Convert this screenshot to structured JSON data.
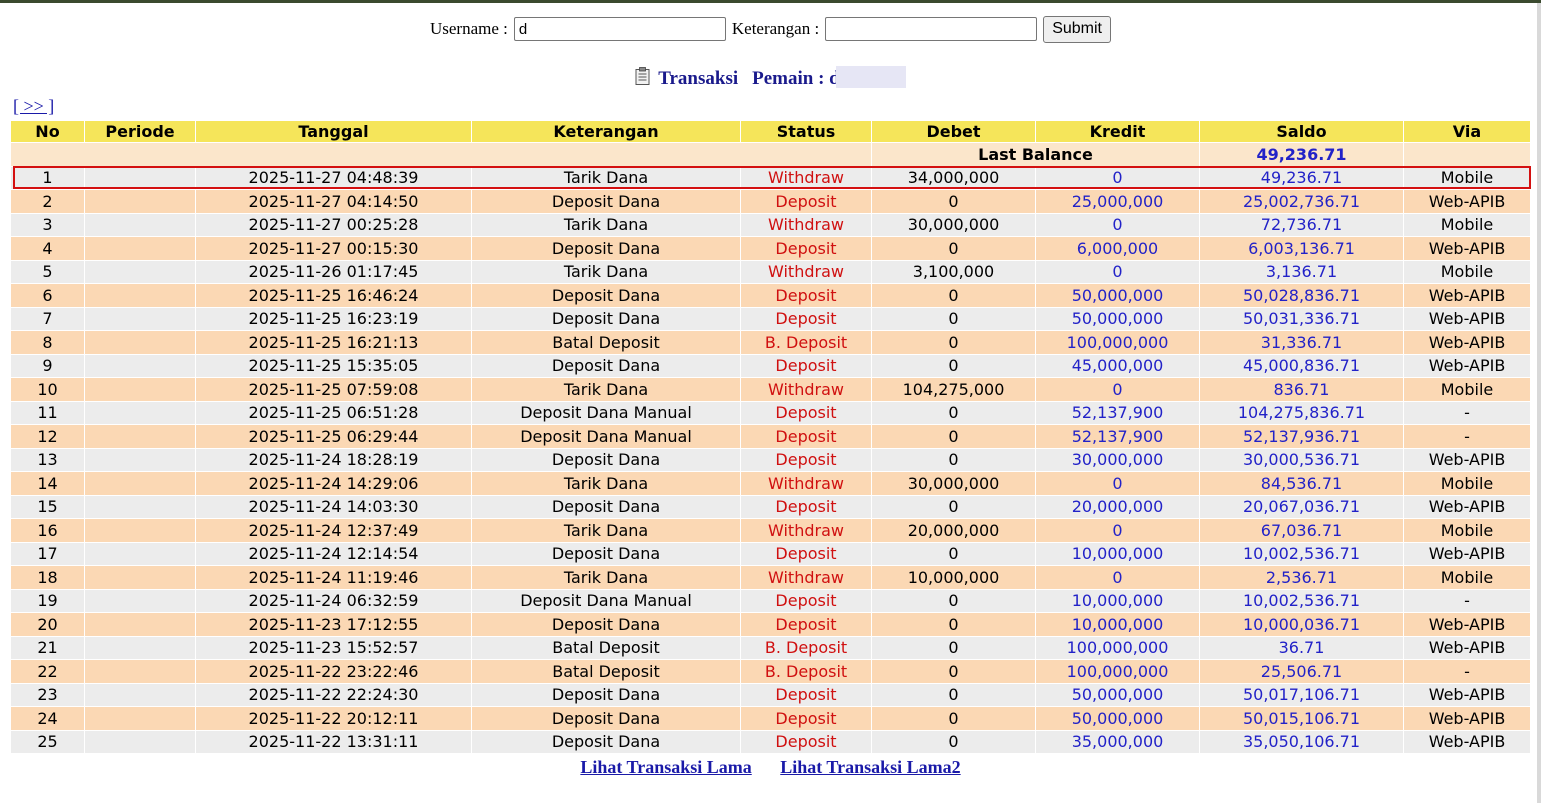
{
  "form": {
    "username_label": "Username :",
    "username_value": "d",
    "keterangan_label": "Keterangan :",
    "keterangan_value": "",
    "submit_label": "Submit"
  },
  "title": {
    "icon": "clipboard-icon",
    "transaksi": "Transaksi",
    "pemain_label": "Pemain : d"
  },
  "nav": {
    "next_label": "[ >> ]"
  },
  "table": {
    "headers": [
      "No",
      "Periode",
      "Tanggal",
      "Keterangan",
      "Status",
      "Debet",
      "Kredit",
      "Saldo",
      "Via"
    ],
    "last_balance_label": "Last Balance",
    "last_balance_value": "49,236.71",
    "rows": [
      [
        "1",
        "",
        "2025-11-27 04:48:39",
        "Tarik Dana",
        "Withdraw",
        "34,000,000",
        "0",
        "49,236.71",
        "Mobile"
      ],
      [
        "2",
        "",
        "2025-11-27 04:14:50",
        "Deposit Dana",
        "Deposit",
        "0",
        "25,000,000",
        "25,002,736.71",
        "Web-APIB"
      ],
      [
        "3",
        "",
        "2025-11-27 00:25:28",
        "Tarik Dana",
        "Withdraw",
        "30,000,000",
        "0",
        "72,736.71",
        "Mobile"
      ],
      [
        "4",
        "",
        "2025-11-27 00:15:30",
        "Deposit Dana",
        "Deposit",
        "0",
        "6,000,000",
        "6,003,136.71",
        "Web-APIB"
      ],
      [
        "5",
        "",
        "2025-11-26 01:17:45",
        "Tarik Dana",
        "Withdraw",
        "3,100,000",
        "0",
        "3,136.71",
        "Mobile"
      ],
      [
        "6",
        "",
        "2025-11-25 16:46:24",
        "Deposit Dana",
        "Deposit",
        "0",
        "50,000,000",
        "50,028,836.71",
        "Web-APIB"
      ],
      [
        "7",
        "",
        "2025-11-25 16:23:19",
        "Deposit Dana",
        "Deposit",
        "0",
        "50,000,000",
        "50,031,336.71",
        "Web-APIB"
      ],
      [
        "8",
        "",
        "2025-11-25 16:21:13",
        "Batal Deposit",
        "B. Deposit",
        "0",
        "100,000,000",
        "31,336.71",
        "Web-APIB"
      ],
      [
        "9",
        "",
        "2025-11-25 15:35:05",
        "Deposit Dana",
        "Deposit",
        "0",
        "45,000,000",
        "45,000,836.71",
        "Web-APIB"
      ],
      [
        "10",
        "",
        "2025-11-25 07:59:08",
        "Tarik Dana",
        "Withdraw",
        "104,275,000",
        "0",
        "836.71",
        "Mobile"
      ],
      [
        "11",
        "",
        "2025-11-25 06:51:28",
        "Deposit Dana Manual",
        "Deposit",
        "0",
        "52,137,900",
        "104,275,836.71",
        "-"
      ],
      [
        "12",
        "",
        "2025-11-25 06:29:44",
        "Deposit Dana Manual",
        "Deposit",
        "0",
        "52,137,900",
        "52,137,936.71",
        "-"
      ],
      [
        "13",
        "",
        "2025-11-24 18:28:19",
        "Deposit Dana",
        "Deposit",
        "0",
        "30,000,000",
        "30,000,536.71",
        "Web-APIB"
      ],
      [
        "14",
        "",
        "2025-11-24 14:29:06",
        "Tarik Dana",
        "Withdraw",
        "30,000,000",
        "0",
        "84,536.71",
        "Mobile"
      ],
      [
        "15",
        "",
        "2025-11-24 14:03:30",
        "Deposit Dana",
        "Deposit",
        "0",
        "20,000,000",
        "20,067,036.71",
        "Web-APIB"
      ],
      [
        "16",
        "",
        "2025-11-24 12:37:49",
        "Tarik Dana",
        "Withdraw",
        "20,000,000",
        "0",
        "67,036.71",
        "Mobile"
      ],
      [
        "17",
        "",
        "2025-11-24 12:14:54",
        "Deposit Dana",
        "Deposit",
        "0",
        "10,000,000",
        "10,002,536.71",
        "Web-APIB"
      ],
      [
        "18",
        "",
        "2025-11-24 11:19:46",
        "Tarik Dana",
        "Withdraw",
        "10,000,000",
        "0",
        "2,536.71",
        "Mobile"
      ],
      [
        "19",
        "",
        "2025-11-24 06:32:59",
        "Deposit Dana Manual",
        "Deposit",
        "0",
        "10,000,000",
        "10,002,536.71",
        "-"
      ],
      [
        "20",
        "",
        "2025-11-23 17:12:55",
        "Deposit Dana",
        "Deposit",
        "0",
        "10,000,000",
        "10,000,036.71",
        "Web-APIB"
      ],
      [
        "21",
        "",
        "2025-11-23 15:52:57",
        "Batal Deposit",
        "B. Deposit",
        "0",
        "100,000,000",
        "36.71",
        "Web-APIB"
      ],
      [
        "22",
        "",
        "2025-11-22 23:22:46",
        "Batal Deposit",
        "B. Deposit",
        "0",
        "100,000,000",
        "25,506.71",
        "-"
      ],
      [
        "23",
        "",
        "2025-11-22 22:24:30",
        "Deposit Dana",
        "Deposit",
        "0",
        "50,000,000",
        "50,017,106.71",
        "Web-APIB"
      ],
      [
        "24",
        "",
        "2025-11-22 20:12:11",
        "Deposit Dana",
        "Deposit",
        "0",
        "50,000,000",
        "50,015,106.71",
        "Web-APIB"
      ],
      [
        "25",
        "",
        "2025-11-22 13:31:11",
        "Deposit Dana",
        "Deposit",
        "0",
        "35,000,000",
        "35,050,106.71",
        "Web-APIB"
      ]
    ]
  },
  "footer": {
    "link1": "Lihat Transaksi Lama",
    "link2": "Lihat Transaksi Lama2"
  },
  "colors": {
    "header_bg": "#f5e55a",
    "row_even": "#fbd8b4",
    "row_odd": "#ececec",
    "status_red": "#d01010",
    "value_blue": "#2222c8",
    "highlight_border": "#d41010"
  }
}
